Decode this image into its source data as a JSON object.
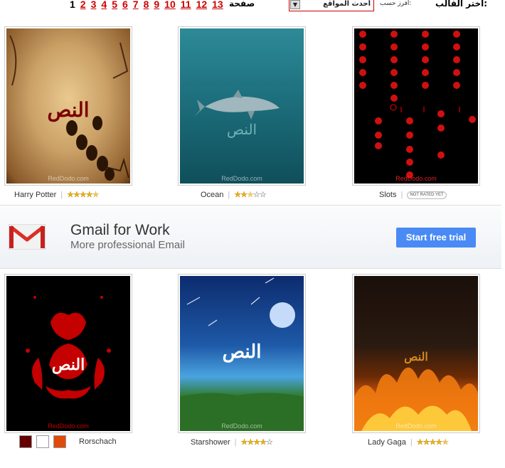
{
  "header": {
    "choose_label": "اختر القالب:",
    "sort_label": "افرز حسب:",
    "sort_value": "أحدث المواقع",
    "page_word": "صفحة",
    "current_page": "1",
    "pages": [
      "2",
      "3",
      "4",
      "5",
      "6",
      "7",
      "8",
      "9",
      "10",
      "11",
      "12",
      "13"
    ]
  },
  "templates": [
    {
      "name": "Harry Potter",
      "arabic": "النص",
      "watermark": "RedDodo.com",
      "rating": 4.5
    },
    {
      "name": "Ocean",
      "arabic": "النص",
      "watermark": "RedDodo.com",
      "rating": 2.5
    },
    {
      "name": "Slots",
      "arabic": "",
      "watermark": "RedDodo.com",
      "rating": null,
      "rating_text": "NOT RATED YET"
    },
    {
      "name": "Rorschach",
      "arabic": "النص",
      "watermark": "RedDodo.com",
      "rating": null
    },
    {
      "name": "Starshower",
      "arabic": "النص",
      "watermark": "RedDodo.com",
      "rating": 4
    },
    {
      "name": "Lady Gaga",
      "arabic": "النص",
      "watermark": "RedDodo.com",
      "rating": 4.5
    }
  ],
  "ad": {
    "title": "Gmail for Work",
    "subtitle": "More professional Email",
    "cta": "Start free trial"
  },
  "colors": {
    "page_link": "#cc0000",
    "cta": "#4a8af4",
    "star": "#f0b400"
  }
}
